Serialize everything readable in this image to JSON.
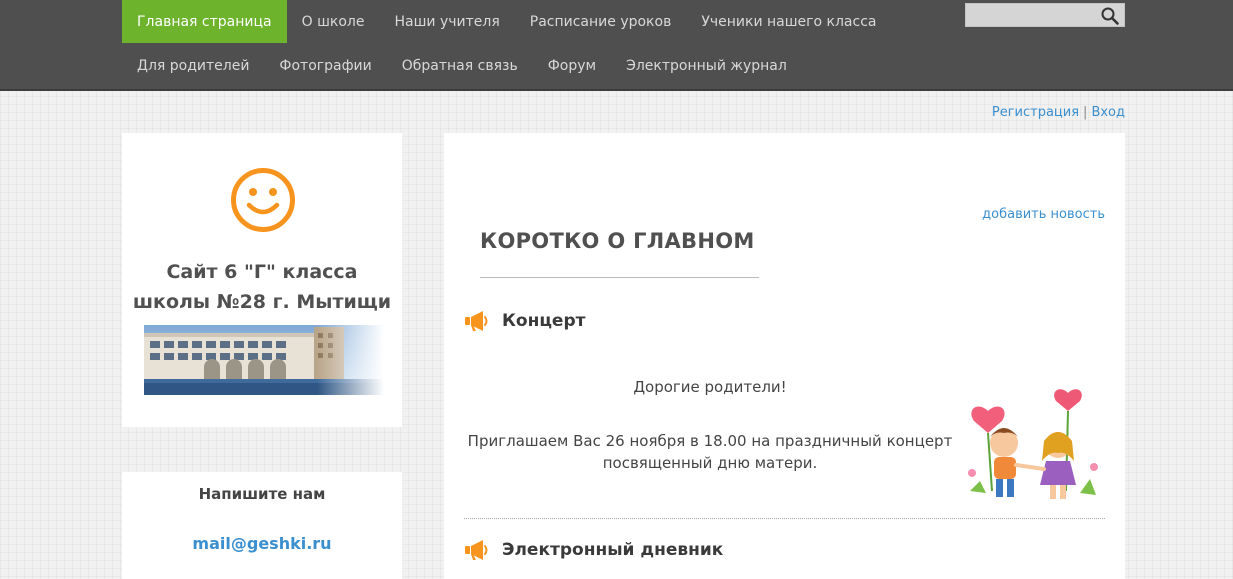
{
  "nav": {
    "row1": [
      {
        "label": "Главная страница",
        "active": true
      },
      {
        "label": "О школе"
      },
      {
        "label": "Наши учителя"
      },
      {
        "label": "Расписание уроков"
      },
      {
        "label": "Ученики нашего класса"
      }
    ],
    "row2": [
      {
        "label": "Для родителей"
      },
      {
        "label": "Фотографии"
      },
      {
        "label": "Обратная связь"
      },
      {
        "label": "Форум"
      },
      {
        "label": "Электронный журнал"
      }
    ],
    "search": {
      "placeholder": ""
    }
  },
  "auth": {
    "register": "Регистрация",
    "separator": "|",
    "login": "Вход"
  },
  "sidebar": {
    "title_line1": "Сайт 6 \"Г\" класса",
    "title_line2": "школы №28 г. Мытищи",
    "contact_title": "Напишите нам",
    "contact_email": "mail@geshki.ru"
  },
  "main": {
    "add_news": "добавить новость",
    "section_title": "КОРОТКО О ГЛАВНОМ",
    "news": [
      {
        "title": "Концерт",
        "greeting": "Дорогие родители!",
        "body": "Приглашаем Вас 26 ноября в 18.00 на праздничный концерт посвященный дню матери."
      },
      {
        "title": "Электронный дневник"
      }
    ]
  },
  "colors": {
    "nav_bg": "#4f4f4f",
    "nav_active": "#6db32c",
    "link": "#3b8fcf",
    "accent_orange": "#f7941d"
  },
  "icons": [
    "search-icon",
    "smiley-icon",
    "megaphone-icon"
  ]
}
